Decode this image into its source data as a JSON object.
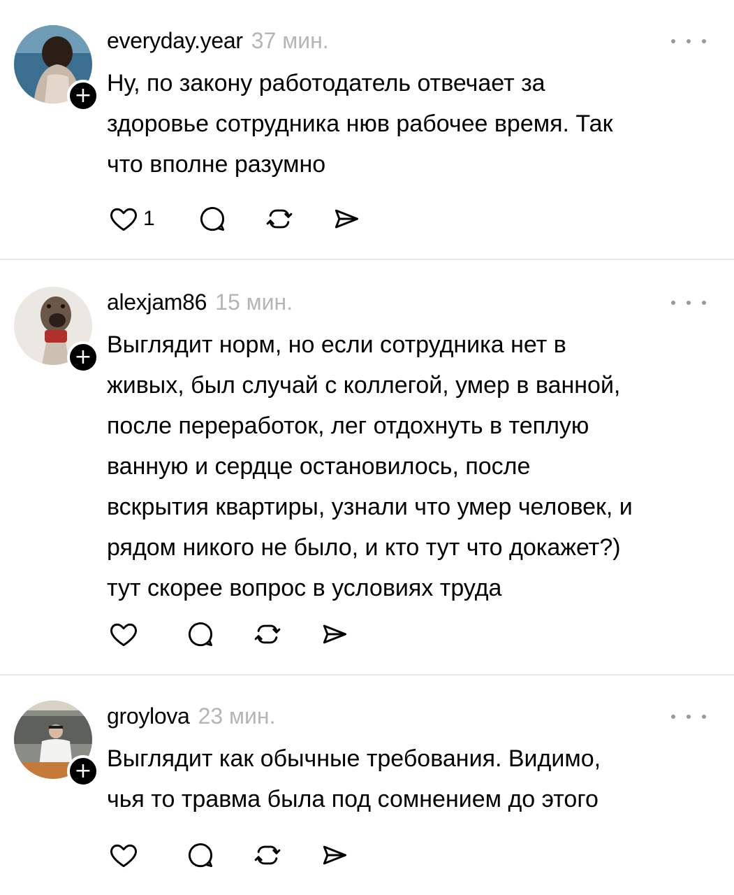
{
  "posts": [
    {
      "username": "everyday.year",
      "time": "37 мин.",
      "text": "Ну, по закону работодатель отвечает за\nздоровье сотрудника нюв рабочее время. Так\nчто вполне разумно",
      "likes": "1",
      "avatar_colors": [
        "#3a6f8f",
        "#c9b8a8",
        "#1e2d3a"
      ]
    },
    {
      "username": "alexjam86",
      "time": "15 мин.",
      "text": "Выглядит норм, но если сотрудника нет в\nживых, был случай с коллегой, умер в ванной,\nпосле переработок, лег отдохнуть в теплую\nванную и сердце остановилось, после\nвскрытия квартиры, узнали что умер человек, и\nрядом никого не было, и кто тут что докажет?)\nтут скорее вопрос в условиях труда",
      "likes": "",
      "avatar_colors": [
        "#ebe7e2",
        "#5b4a3e",
        "#b0312a"
      ]
    },
    {
      "username": "groylova",
      "time": "23 мин.",
      "text": "Выглядит как обычные требования. Видимо,\nчья то травма была под сомнением до этого",
      "likes": "",
      "avatar_colors": [
        "#8a8c86",
        "#f2f2f0",
        "#c57a3a"
      ]
    }
  ],
  "icons": {
    "follow": "plus-icon",
    "more": "more-horizontal-icon",
    "like": "heart-icon",
    "reply": "comment-icon",
    "repost": "repost-icon",
    "share": "send-icon"
  },
  "ui": {
    "follow_glyph": "+"
  }
}
